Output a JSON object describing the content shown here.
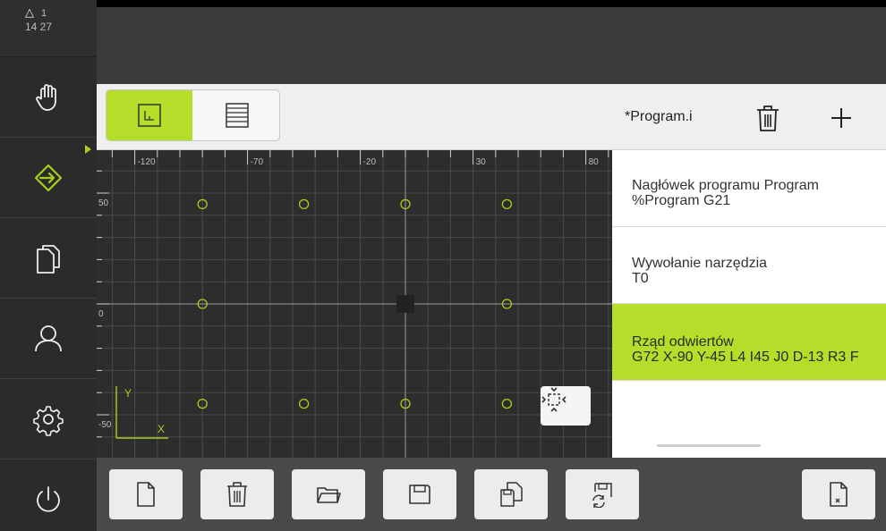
{
  "status": {
    "alert_icon": "warning-triangle-icon",
    "tool_number": "1",
    "time": "14 27"
  },
  "sidebar": {
    "items": [
      {
        "name": "manual-mode",
        "icon": "hand-icon",
        "active": false
      },
      {
        "name": "mdi-mode",
        "icon": "mdi-arrow-icon",
        "active": true
      },
      {
        "name": "file-management",
        "icon": "files-icon",
        "active": false
      },
      {
        "name": "user-login",
        "icon": "user-icon",
        "active": false
      },
      {
        "name": "settings",
        "icon": "gear-icon",
        "active": false
      },
      {
        "name": "power",
        "icon": "power-icon",
        "active": false
      }
    ]
  },
  "toolbar": {
    "view_graphic_icon": "graphic-view-icon",
    "view_list_icon": "list-view-icon"
  },
  "graphic": {
    "x_ticks": [
      "-120",
      "-70",
      "-20",
      "30",
      "80"
    ],
    "y_ticks": [
      "50",
      "0",
      "-50"
    ],
    "axis_y_label": "Y",
    "axis_x_label": "X",
    "holes": [
      {
        "x": -90,
        "y": 45
      },
      {
        "x": -45,
        "y": 45
      },
      {
        "x": 0,
        "y": 45
      },
      {
        "x": 45,
        "y": 45
      },
      {
        "x": -90,
        "y": 0
      },
      {
        "x": 45,
        "y": 0
      },
      {
        "x": -90,
        "y": -45
      },
      {
        "x": -45,
        "y": -45
      },
      {
        "x": 0,
        "y": -45
      },
      {
        "x": 45,
        "y": -45
      }
    ],
    "colors": {
      "background": "#2d2d2d",
      "grid": "#4a4a4a",
      "hole": "#a6d01e",
      "axis": "#9a9a9a"
    }
  },
  "program": {
    "filename": "*Program.i",
    "blocks": [
      {
        "line1": "Nagłówek programu Program",
        "line2": "%Program G21",
        "selected": false
      },
      {
        "line1": "Wywołanie narzędzia",
        "line2": "T0",
        "selected": false
      },
      {
        "line1": "Rząd odwiertów",
        "line2": "G72 X-90 Y-45 L4 I45 J0 D-13 R3 F",
        "selected": true
      }
    ]
  },
  "bottombar": {
    "buttons": [
      "new-file-icon",
      "delete-icon",
      "open-folder-icon",
      "save-icon",
      "save-as-icon",
      "save-reload-icon",
      "close-program-icon"
    ]
  },
  "accent": "#b4de2a"
}
